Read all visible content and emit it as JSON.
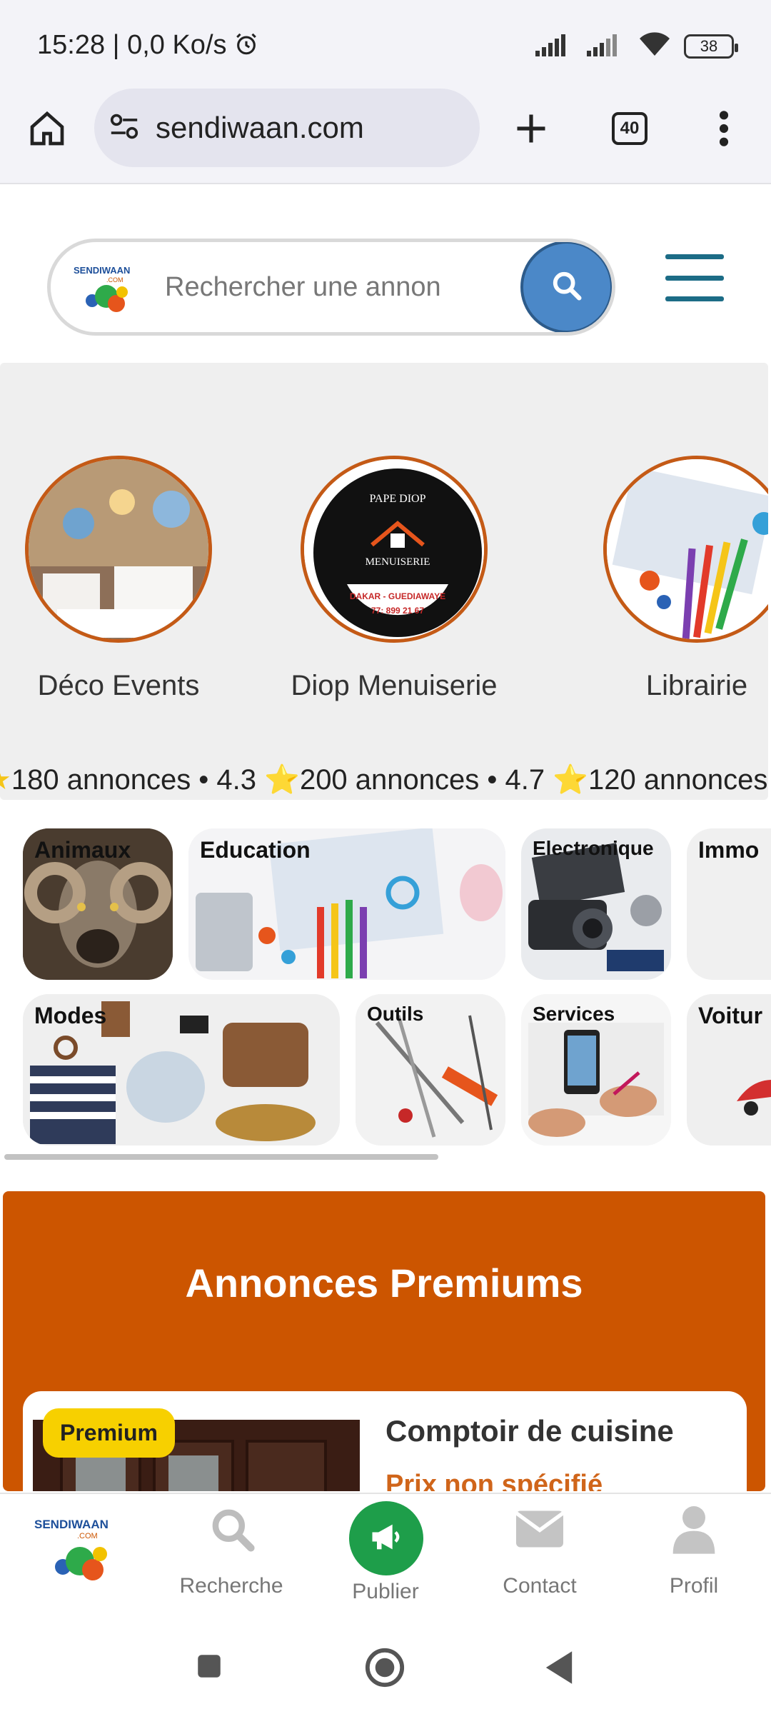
{
  "status_bar": {
    "time": "15:28 | 0,0 Ko/s",
    "battery": "38"
  },
  "browser": {
    "url": "sendiwaan.com",
    "tab_count": "40"
  },
  "search": {
    "placeholder": "Rechercher une annon"
  },
  "logo": {
    "text": "SENDIWAAN",
    "suffix": ".COM"
  },
  "shops": [
    {
      "name": "Déco Events"
    },
    {
      "name": "Diop Menuiserie",
      "logo_text_top": "PAPE DIOP",
      "logo_text_mid": "MENUISERIE",
      "logo_text_city": "DAKAR - GUEDIAWAYE",
      "logo_text_phone": "77: 899 21 67"
    },
    {
      "name": "Librairie"
    }
  ],
  "shop_stats": "180 annonces • 4.3 ⭐200 annonces • 4.7 ⭐120 annonces",
  "categories": {
    "row1": [
      "Animaux",
      "Education",
      "Electronique",
      "Immo"
    ],
    "row2": [
      "Modes",
      "Outils",
      "Services",
      "Voitur"
    ]
  },
  "premium": {
    "title": "Annonces Premiums",
    "card": {
      "badge": "Premium",
      "title": "Comptoir de cuisine",
      "price": "Prix non spécifié"
    }
  },
  "bottom_nav": {
    "search": "Recherche",
    "publish": "Publier",
    "contact": "Contact",
    "profile": "Profil"
  },
  "colors": {
    "accent": "#cc5500",
    "search_button": "#4b88c8",
    "publish": "#1e9e4a",
    "menu": "#1c6c86",
    "badge": "#f7d000"
  }
}
